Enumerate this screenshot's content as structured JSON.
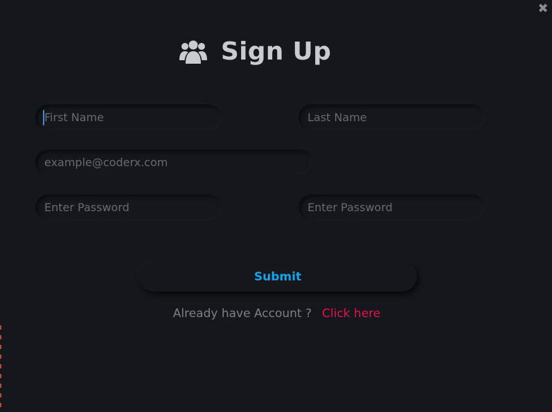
{
  "window": {
    "close_icon": "close-icon",
    "close_glyph": "✖"
  },
  "header": {
    "icon": "users-icon",
    "title": "Sign Up"
  },
  "form": {
    "first_name": {
      "placeholder": "First Name",
      "value": ""
    },
    "last_name": {
      "placeholder": "Last Name",
      "value": ""
    },
    "email": {
      "placeholder": "example@coderx.com",
      "value": ""
    },
    "password": {
      "placeholder": "Enter Password",
      "value": ""
    },
    "confirm_password": {
      "placeholder": "Enter Password",
      "value": ""
    },
    "submit_label": "Submit"
  },
  "footer": {
    "question": "Already have Account ?",
    "link": "Click here"
  },
  "colors": {
    "background": "#15171c",
    "title": "#c9cbcf",
    "submit_text": "#1aa3e8",
    "link": "#e0144c",
    "placeholder": "#676a70"
  }
}
